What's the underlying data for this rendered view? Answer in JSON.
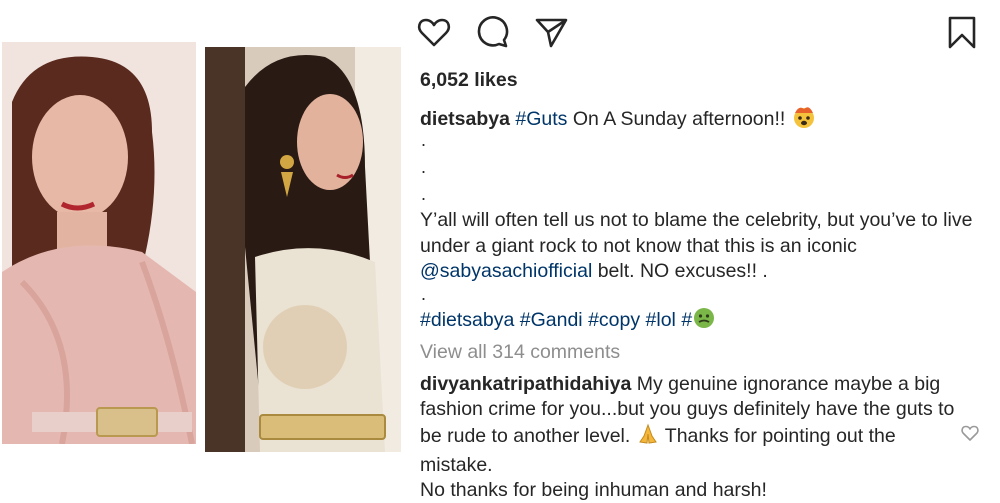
{
  "post": {
    "likes": "6,052 likes",
    "caption": {
      "username": "dietsabya",
      "hashtag": "#Guts",
      "text": " On A Sunday afternoon!! ",
      "dots": [
        ".",
        ".",
        ".",
        "."
      ],
      "body_pre": "Y’all will often tell us not to blame the celebrity, but you’ve to live under a giant rock to not know that this is an iconic ",
      "mention": "@sabyasachiofficial",
      "body_post": " belt. NO excuses!! .",
      "hashtags": [
        "#dietsabya",
        "#Gandi",
        "#copy",
        "#lol",
        "#"
      ]
    },
    "view_comments": "View all 314 comments",
    "comment": {
      "username": "divyankatripathidahiya",
      "text_1": " My genuine ignorance maybe a big fashion crime for you...but you guys definitely have the guts to be rude to another level. ",
      "text_2": " Thanks for pointing out the mistake.",
      "text_3": "No thanks for being inhuman and harsh!"
    }
  },
  "icons": {
    "like": "heart-icon",
    "comment": "speech-bubble-icon",
    "share": "paper-plane-icon",
    "save": "bookmark-icon",
    "comment_like": "small-heart-icon",
    "emoji_1": "exploding-head-emoji",
    "emoji_2": "nauseated-face-emoji",
    "emoji_3": "folded-hands-emoji"
  },
  "colors": {
    "text": "#262626",
    "hashtag": "#003569",
    "muted": "#8e8e8e"
  }
}
